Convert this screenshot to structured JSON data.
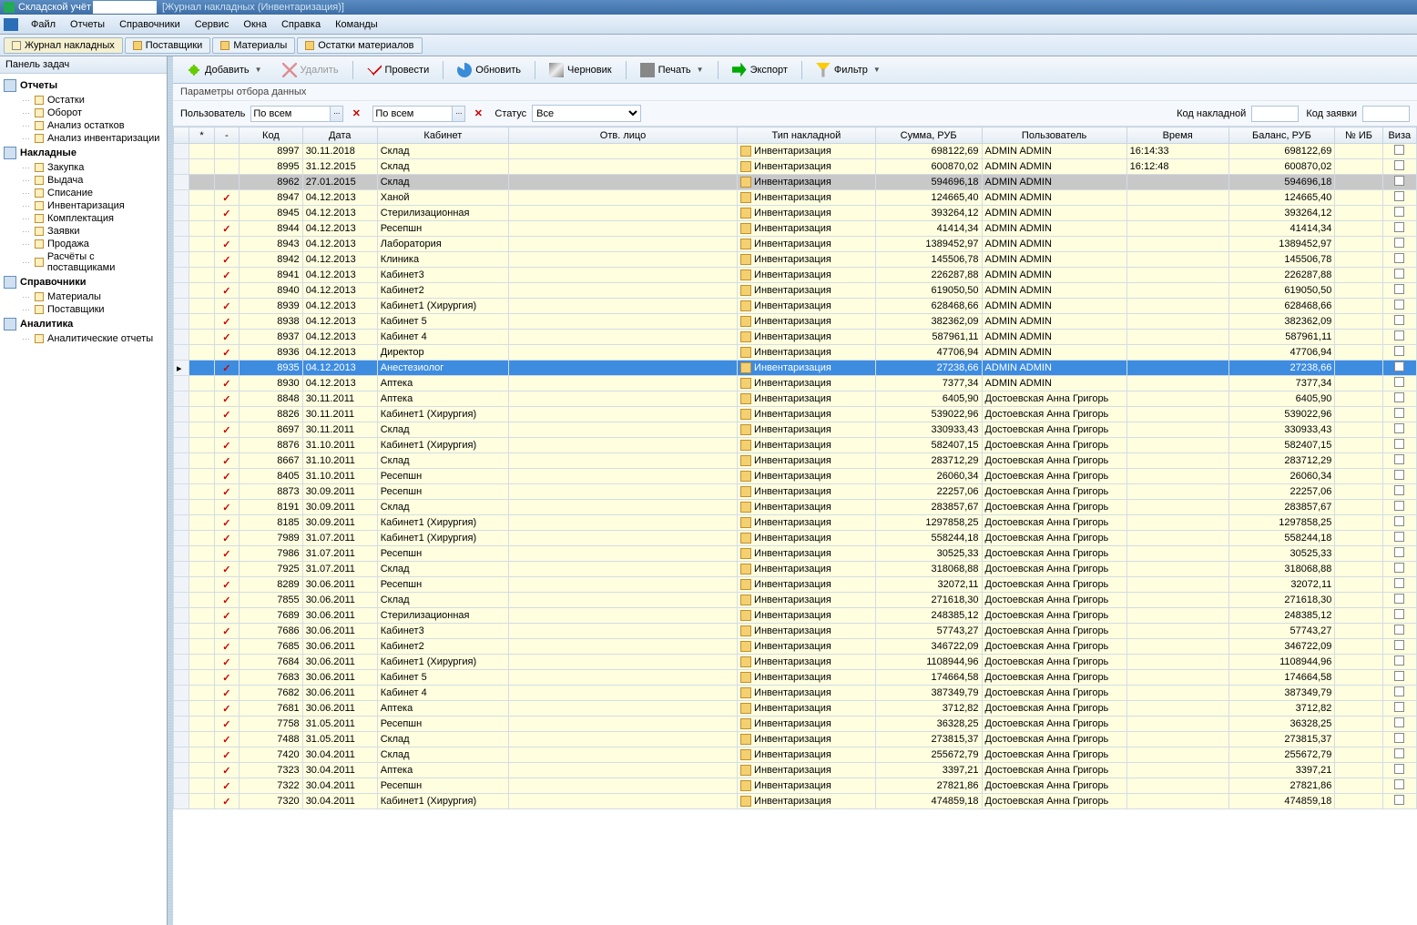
{
  "title": {
    "app": "Складской учёт",
    "sub": "[Журнал накладных  (Инвентаризация)]"
  },
  "menu": [
    "Файл",
    "Отчеты",
    "Справочники",
    "Сервис",
    "Окна",
    "Справка",
    "Команды"
  ],
  "tabs": [
    {
      "label": "Журнал накладных",
      "active": true
    },
    {
      "label": "Поставщики",
      "active": false
    },
    {
      "label": "Материалы",
      "active": false
    },
    {
      "label": "Остатки материалов",
      "active": false
    }
  ],
  "sidebar": {
    "header": "Панель задач",
    "groups": [
      {
        "label": "Отчеты",
        "items": [
          "Остатки",
          "Оборот",
          "Анализ остатков",
          "Анализ инвентаризации"
        ]
      },
      {
        "label": "Накладные",
        "items": [
          "Закупка",
          "Выдача",
          "Списание",
          "Инвентаризация",
          "Комплектация",
          "Заявки",
          "Продажа",
          "Расчёты с поставщиками"
        ]
      },
      {
        "label": "Справочники",
        "items": [
          "Материалы",
          "Поставщики"
        ]
      },
      {
        "label": "Аналитика",
        "items": [
          "Аналитические отчеты"
        ]
      }
    ]
  },
  "toolbar": {
    "add": "Добавить",
    "delete": "Удалить",
    "approve": "Провести",
    "refresh": "Обновить",
    "draft": "Черновик",
    "print": "Печать",
    "export": "Экспорт",
    "filter": "Фильтр"
  },
  "filter_header": "Параметры отбора данных",
  "filter": {
    "user_label": "Пользователь",
    "user_value": "По всем",
    "second_value": "По всем",
    "status_label": "Статус",
    "status_value": "Все",
    "code_label": "Код накладной",
    "req_label": "Код заявки"
  },
  "columns": [
    "",
    "*",
    "-",
    "Код",
    "Дата",
    "Кабинет",
    "Отв. лицо",
    "Тип накладной",
    "Сумма, РУБ",
    "Пользователь",
    "Время",
    "Баланс, РУБ",
    "№ ИБ",
    "Виза"
  ],
  "doc_type": "Инвентаризация",
  "rows": [
    {
      "chk": false,
      "code": "8997",
      "date": "30.11.2018",
      "cab": "Склад",
      "resp": "",
      "sum": "698122,69",
      "user": "ADMIN ADMIN",
      "time": "16:14:33",
      "bal": "698122,69",
      "state": "norm"
    },
    {
      "chk": false,
      "code": "8995",
      "date": "31.12.2015",
      "cab": "Склад",
      "resp": "",
      "sum": "600870,02",
      "user": "ADMIN ADMIN",
      "time": "16:12:48",
      "bal": "600870,02",
      "state": "norm"
    },
    {
      "chk": false,
      "code": "8962",
      "date": "27.01.2015",
      "cab": "Склад",
      "resp": "",
      "sum": "594696,18",
      "user": "ADMIN ADMIN",
      "time": "",
      "bal": "594696,18",
      "state": "gray"
    },
    {
      "chk": true,
      "code": "8947",
      "date": "04.12.2013",
      "cab": "Ханой",
      "resp": "",
      "sum": "124665,40",
      "user": "ADMIN ADMIN",
      "time": "",
      "bal": "124665,40",
      "state": "norm"
    },
    {
      "chk": true,
      "code": "8945",
      "date": "04.12.2013",
      "cab": "Стерилизационная",
      "resp": "",
      "sum": "393264,12",
      "user": "ADMIN ADMIN",
      "time": "",
      "bal": "393264,12",
      "state": "norm"
    },
    {
      "chk": true,
      "code": "8944",
      "date": "04.12.2013",
      "cab": "Ресепшн",
      "resp": "",
      "sum": "41414,34",
      "user": "ADMIN ADMIN",
      "time": "",
      "bal": "41414,34",
      "state": "norm"
    },
    {
      "chk": true,
      "code": "8943",
      "date": "04.12.2013",
      "cab": "Лаборатория",
      "resp": "",
      "sum": "1389452,97",
      "user": "ADMIN ADMIN",
      "time": "",
      "bal": "1389452,97",
      "state": "norm"
    },
    {
      "chk": true,
      "code": "8942",
      "date": "04.12.2013",
      "cab": "Клиника",
      "resp": "",
      "sum": "145506,78",
      "user": "ADMIN ADMIN",
      "time": "",
      "bal": "145506,78",
      "state": "norm"
    },
    {
      "chk": true,
      "code": "8941",
      "date": "04.12.2013",
      "cab": "Кабинет3",
      "resp": "",
      "sum": "226287,88",
      "user": "ADMIN ADMIN",
      "time": "",
      "bal": "226287,88",
      "state": "norm"
    },
    {
      "chk": true,
      "code": "8940",
      "date": "04.12.2013",
      "cab": "Кабинет2",
      "resp": "",
      "sum": "619050,50",
      "user": "ADMIN ADMIN",
      "time": "",
      "bal": "619050,50",
      "state": "norm"
    },
    {
      "chk": true,
      "code": "8939",
      "date": "04.12.2013",
      "cab": "Кабинет1 (Хирургия)",
      "resp": "",
      "sum": "628468,66",
      "user": "ADMIN ADMIN",
      "time": "",
      "bal": "628468,66",
      "state": "norm"
    },
    {
      "chk": true,
      "code": "8938",
      "date": "04.12.2013",
      "cab": "Кабинет 5",
      "resp": "",
      "sum": "382362,09",
      "user": "ADMIN ADMIN",
      "time": "",
      "bal": "382362,09",
      "state": "norm"
    },
    {
      "chk": true,
      "code": "8937",
      "date": "04.12.2013",
      "cab": "Кабинет 4",
      "resp": "",
      "sum": "587961,11",
      "user": "ADMIN ADMIN",
      "time": "",
      "bal": "587961,11",
      "state": "norm"
    },
    {
      "chk": true,
      "code": "8936",
      "date": "04.12.2013",
      "cab": "Директор",
      "resp": "",
      "sum": "47706,94",
      "user": "ADMIN ADMIN",
      "time": "",
      "bal": "47706,94",
      "state": "norm"
    },
    {
      "chk": true,
      "code": "8935",
      "date": "04.12.2013",
      "cab": "Анестезиолог",
      "resp": "",
      "sum": "27238,66",
      "user": "ADMIN ADMIN",
      "time": "",
      "bal": "27238,66",
      "state": "sel"
    },
    {
      "chk": true,
      "code": "8930",
      "date": "04.12.2013",
      "cab": "Аптека",
      "resp": "",
      "sum": "7377,34",
      "user": "ADMIN ADMIN",
      "time": "",
      "bal": "7377,34",
      "state": "norm"
    },
    {
      "chk": true,
      "code": "8848",
      "date": "30.11.2011",
      "cab": "Аптека",
      "resp": "",
      "sum": "6405,90",
      "user": "Достоевская Анна Григорь",
      "time": "",
      "bal": "6405,90",
      "state": "norm"
    },
    {
      "chk": true,
      "code": "8826",
      "date": "30.11.2011",
      "cab": "Кабинет1 (Хирургия)",
      "resp": "",
      "sum": "539022,96",
      "user": "Достоевская Анна Григорь",
      "time": "",
      "bal": "539022,96",
      "state": "norm"
    },
    {
      "chk": true,
      "code": "8697",
      "date": "30.11.2011",
      "cab": "Склад",
      "resp": "",
      "sum": "330933,43",
      "user": "Достоевская Анна Григорь",
      "time": "",
      "bal": "330933,43",
      "state": "norm"
    },
    {
      "chk": true,
      "code": "8876",
      "date": "31.10.2011",
      "cab": "Кабинет1 (Хирургия)",
      "resp": "",
      "sum": "582407,15",
      "user": "Достоевская Анна Григорь",
      "time": "",
      "bal": "582407,15",
      "state": "norm"
    },
    {
      "chk": true,
      "code": "8667",
      "date": "31.10.2011",
      "cab": "Склад",
      "resp": "",
      "sum": "283712,29",
      "user": "Достоевская Анна Григорь",
      "time": "",
      "bal": "283712,29",
      "state": "norm"
    },
    {
      "chk": true,
      "code": "8405",
      "date": "31.10.2011",
      "cab": "Ресепшн",
      "resp": "",
      "sum": "26060,34",
      "user": "Достоевская Анна Григорь",
      "time": "",
      "bal": "26060,34",
      "state": "norm"
    },
    {
      "chk": true,
      "code": "8873",
      "date": "30.09.2011",
      "cab": "Ресепшн",
      "resp": "",
      "sum": "22257,06",
      "user": "Достоевская Анна Григорь",
      "time": "",
      "bal": "22257,06",
      "state": "norm"
    },
    {
      "chk": true,
      "code": "8191",
      "date": "30.09.2011",
      "cab": "Склад",
      "resp": "",
      "sum": "283857,67",
      "user": "Достоевская Анна Григорь",
      "time": "",
      "bal": "283857,67",
      "state": "norm"
    },
    {
      "chk": true,
      "code": "8185",
      "date": "30.09.2011",
      "cab": "Кабинет1 (Хирургия)",
      "resp": "",
      "sum": "1297858,25",
      "user": "Достоевская Анна Григорь",
      "time": "",
      "bal": "1297858,25",
      "state": "norm"
    },
    {
      "chk": true,
      "code": "7989",
      "date": "31.07.2011",
      "cab": "Кабинет1 (Хирургия)",
      "resp": "",
      "sum": "558244,18",
      "user": "Достоевская Анна Григорь",
      "time": "",
      "bal": "558244,18",
      "state": "norm"
    },
    {
      "chk": true,
      "code": "7986",
      "date": "31.07.2011",
      "cab": "Ресепшн",
      "resp": "",
      "sum": "30525,33",
      "user": "Достоевская Анна Григорь",
      "time": "",
      "bal": "30525,33",
      "state": "norm"
    },
    {
      "chk": true,
      "code": "7925",
      "date": "31.07.2011",
      "cab": "Склад",
      "resp": "",
      "sum": "318068,88",
      "user": "Достоевская Анна Григорь",
      "time": "",
      "bal": "318068,88",
      "state": "norm"
    },
    {
      "chk": true,
      "code": "8289",
      "date": "30.06.2011",
      "cab": "Ресепшн",
      "resp": "",
      "sum": "32072,11",
      "user": "Достоевская Анна Григорь",
      "time": "",
      "bal": "32072,11",
      "state": "norm"
    },
    {
      "chk": true,
      "code": "7855",
      "date": "30.06.2011",
      "cab": "Склад",
      "resp": "",
      "sum": "271618,30",
      "user": "Достоевская Анна Григорь",
      "time": "",
      "bal": "271618,30",
      "state": "norm"
    },
    {
      "chk": true,
      "code": "7689",
      "date": "30.06.2011",
      "cab": "Стерилизационная",
      "resp": "",
      "sum": "248385,12",
      "user": "Достоевская Анна Григорь",
      "time": "",
      "bal": "248385,12",
      "state": "norm"
    },
    {
      "chk": true,
      "code": "7686",
      "date": "30.06.2011",
      "cab": "Кабинет3",
      "resp": "",
      "sum": "57743,27",
      "user": "Достоевская Анна Григорь",
      "time": "",
      "bal": "57743,27",
      "state": "norm"
    },
    {
      "chk": true,
      "code": "7685",
      "date": "30.06.2011",
      "cab": "Кабинет2",
      "resp": "",
      "sum": "346722,09",
      "user": "Достоевская Анна Григорь",
      "time": "",
      "bal": "346722,09",
      "state": "norm"
    },
    {
      "chk": true,
      "code": "7684",
      "date": "30.06.2011",
      "cab": "Кабинет1 (Хирургия)",
      "resp": "",
      "sum": "1108944,96",
      "user": "Достоевская Анна Григорь",
      "time": "",
      "bal": "1108944,96",
      "state": "norm"
    },
    {
      "chk": true,
      "code": "7683",
      "date": "30.06.2011",
      "cab": "Кабинет 5",
      "resp": "",
      "sum": "174664,58",
      "user": "Достоевская Анна Григорь",
      "time": "",
      "bal": "174664,58",
      "state": "norm"
    },
    {
      "chk": true,
      "code": "7682",
      "date": "30.06.2011",
      "cab": "Кабинет 4",
      "resp": "",
      "sum": "387349,79",
      "user": "Достоевская Анна Григорь",
      "time": "",
      "bal": "387349,79",
      "state": "norm"
    },
    {
      "chk": true,
      "code": "7681",
      "date": "30.06.2011",
      "cab": "Аптека",
      "resp": "",
      "sum": "3712,82",
      "user": "Достоевская Анна Григорь",
      "time": "",
      "bal": "3712,82",
      "state": "norm"
    },
    {
      "chk": true,
      "code": "7758",
      "date": "31.05.2011",
      "cab": "Ресепшн",
      "resp": "",
      "sum": "36328,25",
      "user": "Достоевская Анна Григорь",
      "time": "",
      "bal": "36328,25",
      "state": "norm"
    },
    {
      "chk": true,
      "code": "7488",
      "date": "31.05.2011",
      "cab": "Склад",
      "resp": "",
      "sum": "273815,37",
      "user": "Достоевская Анна Григорь",
      "time": "",
      "bal": "273815,37",
      "state": "norm"
    },
    {
      "chk": true,
      "code": "7420",
      "date": "30.04.2011",
      "cab": "Склад",
      "resp": "",
      "sum": "255672,79",
      "user": "Достоевская Анна Григорь",
      "time": "",
      "bal": "255672,79",
      "state": "norm"
    },
    {
      "chk": true,
      "code": "7323",
      "date": "30.04.2011",
      "cab": "Аптека",
      "resp": "",
      "sum": "3397,21",
      "user": "Достоевская Анна Григорь",
      "time": "",
      "bal": "3397,21",
      "state": "norm"
    },
    {
      "chk": true,
      "code": "7322",
      "date": "30.04.2011",
      "cab": "Ресепшн",
      "resp": "",
      "sum": "27821,86",
      "user": "Достоевская Анна Григорь",
      "time": "",
      "bal": "27821,86",
      "state": "norm"
    },
    {
      "chk": true,
      "code": "7320",
      "date": "30.04.2011",
      "cab": "Кабинет1 (Хирургия)",
      "resp": "",
      "sum": "474859,18",
      "user": "Достоевская Анна Григорь",
      "time": "",
      "bal": "474859,18",
      "state": "norm"
    }
  ]
}
